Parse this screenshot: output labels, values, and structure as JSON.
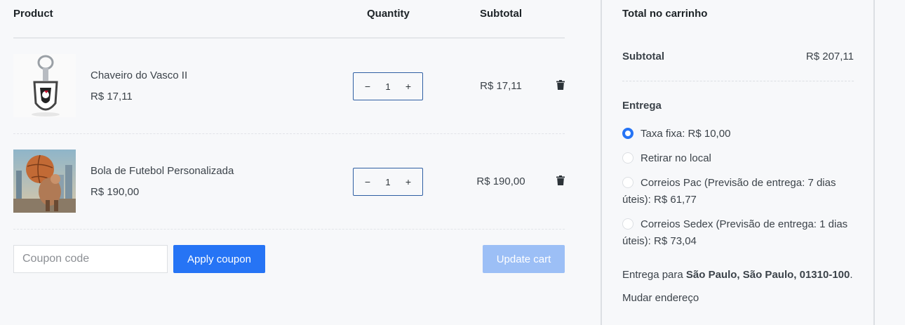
{
  "cart": {
    "headers": {
      "product": "Product",
      "quantity": "Quantity",
      "subtotal": "Subtotal"
    },
    "items": [
      {
        "name": "Chaveiro do Vasco II",
        "price": "R$ 17,11",
        "quantity": "1",
        "subtotal": "R$ 17,11",
        "decrement": "−",
        "increment": "+"
      },
      {
        "name": "Bola de Futebol Personalizada",
        "price": "R$ 190,00",
        "quantity": "1",
        "subtotal": "R$ 190,00",
        "decrement": "−",
        "increment": "+"
      }
    ],
    "coupon_placeholder": "Coupon code",
    "apply_label": "Apply coupon",
    "update_label": "Update cart"
  },
  "totals": {
    "title": "Total no carrinho",
    "subtotal_label": "Subtotal",
    "subtotal_value": "R$ 207,11",
    "shipping_title": "Entrega",
    "shipping_options": [
      {
        "label": "Taxa fixa: R$ 10,00",
        "selected": true
      },
      {
        "label": "Retirar no local",
        "selected": false
      },
      {
        "label": "Correios Pac (Previsão de entrega: 7 dias úteis): R$ 61,77",
        "selected": false
      },
      {
        "label": "Correios Sedex (Previsão de entrega: 1 dias úteis): R$ 73,04",
        "selected": false
      }
    ],
    "ship_to_prefix": "Entrega para ",
    "ship_to_address": "São Paulo, São Paulo, 01310-100",
    "ship_to_suffix": ".",
    "change_address": "Mudar endereço"
  },
  "colors": {
    "accent": "#2674f5",
    "accent_disabled": "#9cbff6",
    "qty_border": "#2f5fa3"
  }
}
